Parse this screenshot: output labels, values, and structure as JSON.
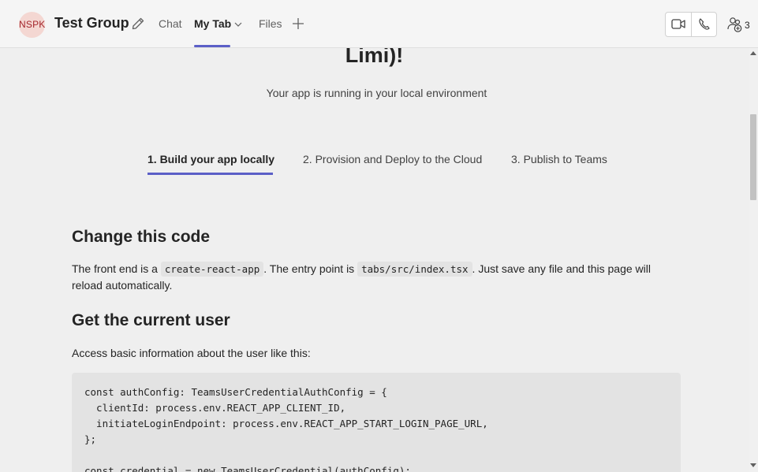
{
  "header": {
    "avatar_initials": "NSPK",
    "group_title": "Test Group",
    "tabs": [
      {
        "label": "Chat"
      },
      {
        "label": "My Tab"
      },
      {
        "label": "Files"
      }
    ],
    "participant_count": "3",
    "accent_color": "#5b5fc7"
  },
  "main": {
    "greeting_tail": "Limi)!",
    "subtitle": "Your app is running in your local environment",
    "steps": [
      {
        "label": "1. Build your app locally"
      },
      {
        "label": "2. Provision and Deploy to the Cloud"
      },
      {
        "label": "3. Publish to Teams"
      }
    ],
    "section1": {
      "heading": "Change this code",
      "text_a": "The front end is a ",
      "code_a": "create-react-app",
      "text_b": ". The entry point is ",
      "code_b": "tabs/src/index.tsx",
      "text_c": ". Just save any file and this page will reload automatically."
    },
    "section2": {
      "heading": "Get the current user",
      "text": "Access basic information about the user like this:",
      "code": "const authConfig: TeamsUserCredentialAuthConfig = {\n  clientId: process.env.REACT_APP_CLIENT_ID,\n  initiateLoginEndpoint: process.env.REACT_APP_START_LOGIN_PAGE_URL,\n};\n\nconst credential = new TeamsUserCredential(authConfig);"
    }
  }
}
